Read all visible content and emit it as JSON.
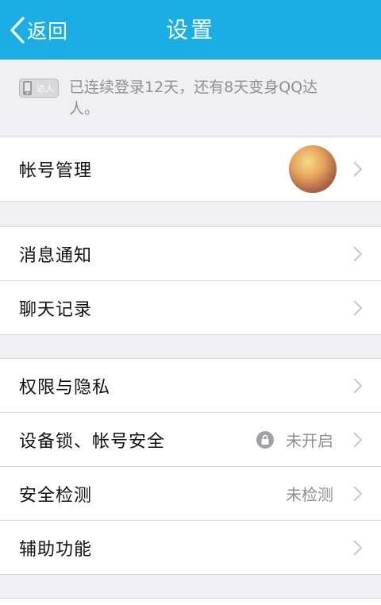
{
  "header": {
    "back_label": "返回",
    "title": "设置"
  },
  "notice": {
    "badge_label": "达人",
    "text": "已连续登录12天，还有8天变身QQ达人。"
  },
  "rows": {
    "account": {
      "label": "帐号管理"
    },
    "notify": {
      "label": "消息通知"
    },
    "chat": {
      "label": "聊天记录"
    },
    "privacy": {
      "label": "权限与隐私"
    },
    "device_lock": {
      "label": "设备锁、帐号安全",
      "value": "未开启"
    },
    "security": {
      "label": "安全检测",
      "value": "未检测"
    },
    "assist": {
      "label": "辅助功能"
    }
  },
  "colors": {
    "header_bg": "#1aaee5",
    "page_bg": "#efeff4",
    "secondary_text": "#8f8f94"
  },
  "icons": {
    "back": "back-arrow-icon",
    "chevron": "chevron-right-icon",
    "lock": "lock-icon",
    "badge": "phone-badge-icon"
  }
}
